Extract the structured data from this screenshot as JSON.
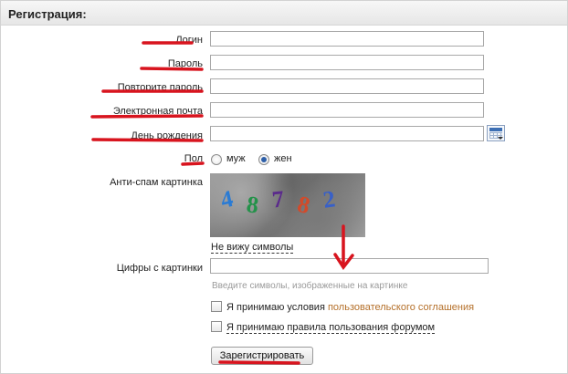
{
  "form": {
    "title": "Регистрация:",
    "fields": {
      "login": {
        "label": "Логин",
        "value": ""
      },
      "password": {
        "label": "Пароль",
        "value": ""
      },
      "password_repeat": {
        "label": "Повторите пароль",
        "value": ""
      },
      "email": {
        "label": "Электронная почта",
        "value": ""
      },
      "birthday": {
        "label": "День рождения",
        "value": ""
      }
    },
    "gender": {
      "label": "Пол",
      "options": [
        {
          "label": "муж",
          "selected": false
        },
        {
          "label": "жен",
          "selected": true
        }
      ]
    },
    "captcha": {
      "label": "Анти-спам картинка",
      "image_text": "48782",
      "cant_see_link": "Не вижу символы"
    },
    "captcha_input": {
      "label": "Цифры с картинки",
      "value": "",
      "hint": "Введите символы, изображенные на картинке"
    },
    "agreements": {
      "terms_prefix": "Я принимаю условия",
      "terms_link": "пользовательского соглашения",
      "terms_checked": false,
      "forum_rules": "Я принимаю правила пользования форумом",
      "forum_checked": false
    },
    "submit_label": "Зарегистрировать"
  },
  "colors": {
    "annotation_red": "#d8141e",
    "link_orange": "#b5702a",
    "radio_selected": "#2e5fa8"
  }
}
